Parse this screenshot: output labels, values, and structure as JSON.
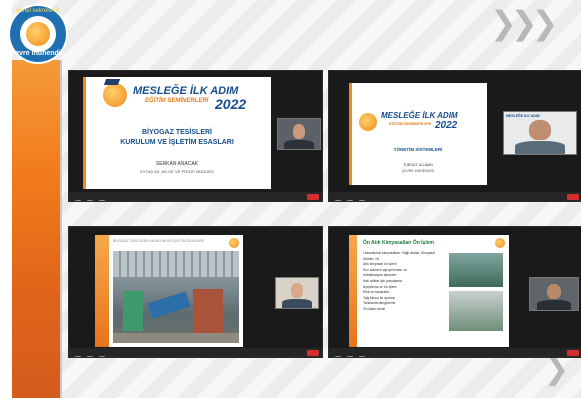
{
  "brand": {
    "logo_top": "genel sekreterlik",
    "logo_bottom": "çevre mühendis"
  },
  "decor": {
    "chevron_top": "❯❯❯",
    "chevron_bottom": "❯"
  },
  "tiles": [
    {
      "banner_line1": "MESLEĞE İLK ADIM",
      "banner_line2": "EĞİTİM SEMİNERLERİ",
      "year": "2022",
      "title_line1": "BİYOGAZ TESİSLERİ",
      "title_line2": "KURULUM VE İŞLETİM ESASLARI",
      "presenter": "SERKAN ANACAK",
      "presenter_role": "EXTAŞ AŞ. AR-GE VE PROJE MÜDÜRÜ"
    },
    {
      "banner_line1": "MESLEĞE İLK ADIM",
      "banner_line2": "EĞİTİM SEMİNERLERİ",
      "year": "2022",
      "title_line1": "YÖNETİM SİSTEMLERİ",
      "presenter": "TURGUT ULUŞAN",
      "presenter_role": "ÇEVRE MÜHENDİSİ",
      "cam_banner": "MESLEĞE İLK ADIM"
    },
    {
      "slide_header": "BİYOGAZ TESİSLERİ KURULUM VE İŞLETİM ESASLARI"
    },
    {
      "slide_header": "Ön Atık Kimyasalları Ön İşlem",
      "text_lines": [
        "Laboratuvar kimyasalları: Yağlı atıklar, Kimyasal ürünler, vb.",
        "Atık kimyasal ön işlem",
        "Sıvı atıkların ayrıştırılması ve",
        "nötralizasyon işlemleri",
        "Katı atıklar için parçalama",
        "Ayrıştırma ve ön işlem",
        "Elek ve separatör",
        "Yağ tutucu ile ayırma",
        "Tanklarda dengeleme",
        "Ön işlem tesisi"
      ]
    }
  ],
  "colors": {
    "accent": "#f08a1c",
    "brand_blue": "#174f8c",
    "leave": "#d32f2f"
  }
}
